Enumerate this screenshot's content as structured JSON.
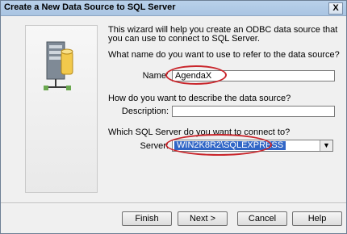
{
  "window": {
    "title": "Create a New Data Source to SQL Server",
    "close_label": "X"
  },
  "intro_text": "This wizard will help you create an ODBC data source that you can use to connect to SQL Server.",
  "name_section": {
    "question": "What name do you want to use to refer to the data source?",
    "label": "Name:",
    "value": "AgendaX"
  },
  "description_section": {
    "question": "How do you want to describe the data source?",
    "label": "Description:",
    "value": ""
  },
  "server_section": {
    "question": "Which SQL Server do you want to connect to?",
    "label": "Server:",
    "value": "WIN2K8R2\\SQLEXPRESS",
    "arrow": "▼"
  },
  "buttons": {
    "finish": "Finish",
    "next": "Next >",
    "cancel": "Cancel",
    "help": "Help"
  },
  "colors": {
    "annotation_ring": "#c9262c",
    "selection": "#3166c6"
  }
}
